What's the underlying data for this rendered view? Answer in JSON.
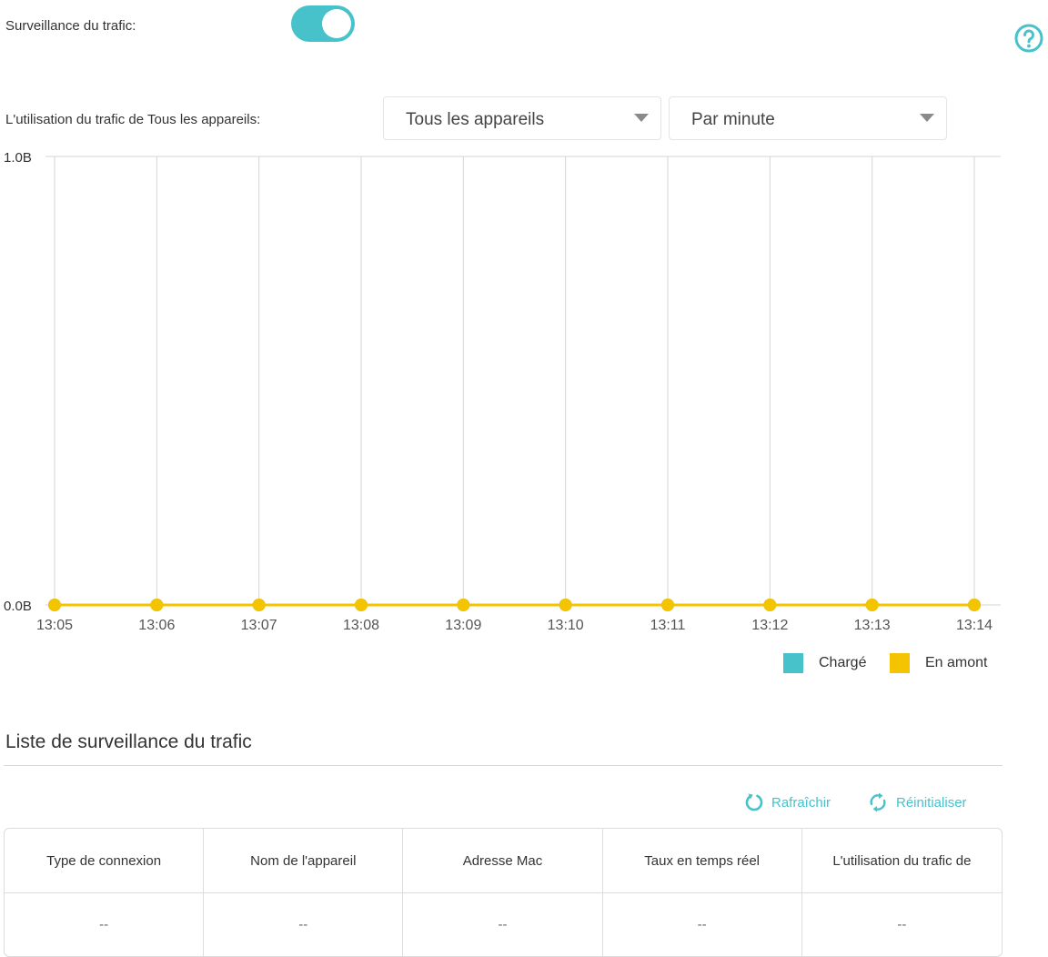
{
  "monitor": {
    "label": "Surveillance du trafic:",
    "enabled": true,
    "toggle_color": "#47c2cb",
    "help_icon": "question-circle-icon"
  },
  "usage": {
    "label": "L'utilisation du trafic de Tous les appareils:",
    "device_select": "Tous les appareils",
    "interval_select": "Par minute"
  },
  "chart_data": {
    "type": "line",
    "x": [
      "13:05",
      "13:06",
      "13:07",
      "13:08",
      "13:09",
      "13:10",
      "13:11",
      "13:12",
      "13:13",
      "13:14"
    ],
    "ylim": [
      0,
      1
    ],
    "y_ticks": [
      "0.0B",
      "1.0B"
    ],
    "grid": "vertical",
    "legend_position": "bottom-right",
    "series": [
      {
        "name": "Chargé",
        "color": "#47c2cb",
        "values": [
          0,
          0,
          0,
          0,
          0,
          0,
          0,
          0,
          0,
          0
        ]
      },
      {
        "name": "En amont",
        "color": "#f5c400",
        "values": [
          0,
          0,
          0,
          0,
          0,
          0,
          0,
          0,
          0,
          0
        ]
      }
    ]
  },
  "list": {
    "title": "Liste de surveillance du trafic",
    "refresh_label": "Rafraîchir",
    "reset_label": "Réinitialiser",
    "accent_color": "#47c2cb",
    "columns": [
      "Type de connexion",
      "Nom de l'appareil",
      "Adresse Mac",
      "Taux en temps réel",
      "L'utilisation du trafic de"
    ],
    "rows": [
      [
        "--",
        "--",
        "--",
        "--",
        "--"
      ]
    ]
  }
}
